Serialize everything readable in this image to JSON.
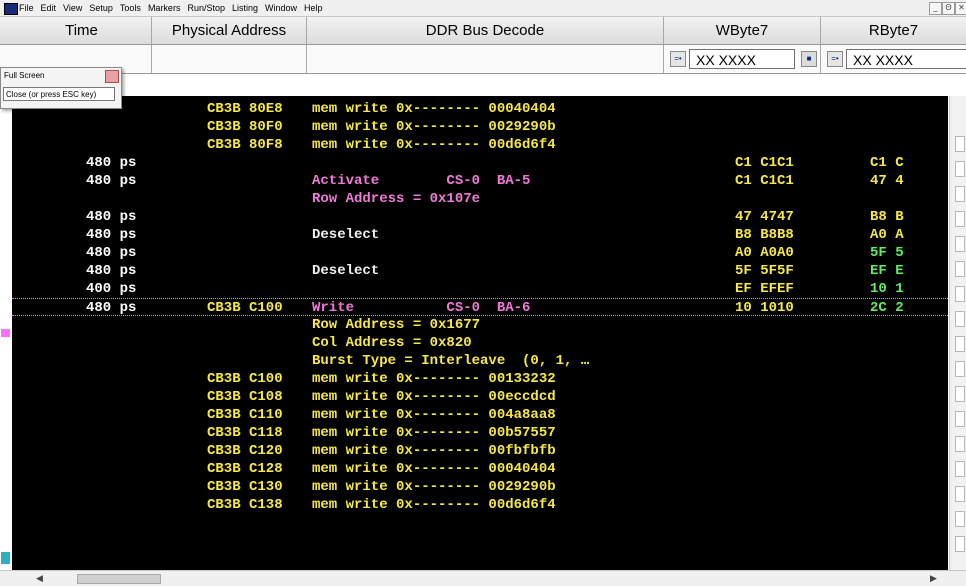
{
  "menu": [
    "File",
    "Edit",
    "View",
    "Setup",
    "Tools",
    "Markers",
    "Run/Stop",
    "Listing",
    "Window",
    "Help"
  ],
  "window_controls": [
    "_",
    "Θ",
    "✕"
  ],
  "columns": {
    "time": "Time",
    "phys": "Physical Address",
    "ddr": "DDR Bus Decode",
    "wbyte": "WByte7",
    "rbyte": "RByte7"
  },
  "filters": {
    "wbyte_value": "XX XXXX",
    "rbyte_value": "XX XXXX"
  },
  "popup": {
    "title": "Full Screen",
    "close_button": "Close (or press ESC key)"
  },
  "colors": {
    "background": "#000000",
    "yellow_text": "#f6e84a",
    "pink_text": "#f07ad8",
    "green_text": "#60ee60",
    "selection_marker": "#ff6cff"
  },
  "rows": [
    {
      "time": "",
      "addr": "CB3B 80E8",
      "decode": "mem write 0x-------- 00040404",
      "dcolor": "yellow",
      "w": "",
      "wcolor": "",
      "r": "",
      "rcolor": ""
    },
    {
      "time": "",
      "addr": "CB3B 80F0",
      "decode": "mem write 0x-------- 0029290b",
      "dcolor": "yellow",
      "w": "",
      "wcolor": "",
      "r": "",
      "rcolor": ""
    },
    {
      "time": "",
      "addr": "CB3B 80F8",
      "decode": "mem write 0x-------- 00d6d6f4",
      "dcolor": "yellow",
      "w": "",
      "wcolor": "",
      "r": "",
      "rcolor": ""
    },
    {
      "time": "480 ps",
      "addr": "",
      "decode": "",
      "dcolor": "",
      "w": "C1 C1C1",
      "wcolor": "yellow",
      "r": "C1 C",
      "rcolor": "yellow"
    },
    {
      "time": "480 ps",
      "addr": "",
      "decode": "Activate        CS-0  BA-5",
      "dcolor": "pink",
      "w": "C1 C1C1",
      "wcolor": "yellow",
      "r": "47 4",
      "rcolor": "yellow"
    },
    {
      "time": "",
      "addr": "",
      "decode": "Row Address = 0x107e",
      "dcolor": "pink",
      "w": "",
      "wcolor": "",
      "r": "",
      "rcolor": ""
    },
    {
      "time": "480 ps",
      "addr": "",
      "decode": "",
      "dcolor": "",
      "w": "47 4747",
      "wcolor": "yellow",
      "r": "B8 B",
      "rcolor": "yellow"
    },
    {
      "time": "480 ps",
      "addr": "",
      "decode": "Deselect",
      "dcolor": "white",
      "w": "B8 B8B8",
      "wcolor": "yellow",
      "r": "A0 A",
      "rcolor": "yellow"
    },
    {
      "time": "480 ps",
      "addr": "",
      "decode": "",
      "dcolor": "",
      "w": "A0 A0A0",
      "wcolor": "yellow",
      "r": "5F 5",
      "rcolor": "green"
    },
    {
      "time": "480 ps",
      "addr": "",
      "decode": "Deselect",
      "dcolor": "white",
      "w": "5F 5F5F",
      "wcolor": "yellow",
      "r": "EF E",
      "rcolor": "green"
    },
    {
      "time": "400 ps",
      "addr": "",
      "decode": "",
      "dcolor": "",
      "w": "EF EFEF",
      "wcolor": "yellow",
      "r": "10 1",
      "rcolor": "green"
    },
    {
      "time": "480 ps",
      "addr": "CB3B C100",
      "decode": "Write           CS-0  BA-6",
      "dcolor": "pink",
      "w": "10 1010",
      "wcolor": "yellow",
      "r": "2C 2",
      "rcolor": "green",
      "selected": true
    },
    {
      "time": "",
      "addr": "",
      "decode": "Row Address = 0x1677",
      "dcolor": "yellow",
      "w": "",
      "wcolor": "",
      "r": "",
      "rcolor": ""
    },
    {
      "time": "",
      "addr": "",
      "decode": "Col Address = 0x820",
      "dcolor": "yellow",
      "w": "",
      "wcolor": "",
      "r": "",
      "rcolor": ""
    },
    {
      "time": "",
      "addr": "",
      "decode": "Burst Type = Interleave  (0, 1, …",
      "dcolor": "yellow",
      "w": "",
      "wcolor": "",
      "r": "",
      "rcolor": ""
    },
    {
      "time": "",
      "addr": "CB3B C100",
      "decode": "mem write 0x-------- 00133232",
      "dcolor": "yellow",
      "w": "",
      "wcolor": "",
      "r": "",
      "rcolor": ""
    },
    {
      "time": "",
      "addr": "CB3B C108",
      "decode": "mem write 0x-------- 00eccdcd",
      "dcolor": "yellow",
      "w": "",
      "wcolor": "",
      "r": "",
      "rcolor": ""
    },
    {
      "time": "",
      "addr": "CB3B C110",
      "decode": "mem write 0x-------- 004a8aa8",
      "dcolor": "yellow",
      "w": "",
      "wcolor": "",
      "r": "",
      "rcolor": ""
    },
    {
      "time": "",
      "addr": "CB3B C118",
      "decode": "mem write 0x-------- 00b57557",
      "dcolor": "yellow",
      "w": "",
      "wcolor": "",
      "r": "",
      "rcolor": ""
    },
    {
      "time": "",
      "addr": "CB3B C120",
      "decode": "mem write 0x-------- 00fbfbfb",
      "dcolor": "yellow",
      "w": "",
      "wcolor": "",
      "r": "",
      "rcolor": ""
    },
    {
      "time": "",
      "addr": "CB3B C128",
      "decode": "mem write 0x-------- 00040404",
      "dcolor": "yellow",
      "w": "",
      "wcolor": "",
      "r": "",
      "rcolor": ""
    },
    {
      "time": "",
      "addr": "CB3B C130",
      "decode": "mem write 0x-------- 0029290b",
      "dcolor": "yellow",
      "w": "",
      "wcolor": "",
      "r": "",
      "rcolor": ""
    },
    {
      "time": "",
      "addr": "CB3B C138",
      "decode": "mem write 0x-------- 00d6d6f4",
      "dcolor": "yellow",
      "w": "",
      "wcolor": "",
      "r": "",
      "rcolor": ""
    }
  ]
}
